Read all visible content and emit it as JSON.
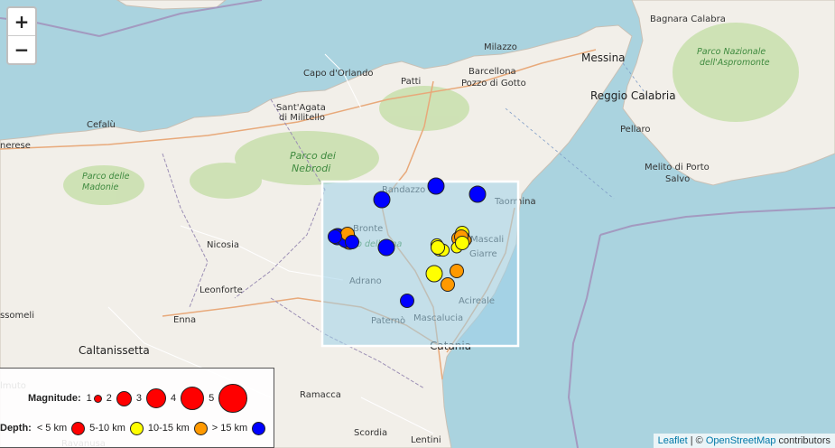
{
  "map": {
    "zoom_in_label": "+",
    "zoom_out_label": "−",
    "places": [
      {
        "name": "Bagnara Calabra",
        "cls": "place"
      },
      {
        "name": "Milazzo",
        "cls": "place"
      },
      {
        "name": "Messina",
        "cls": "place-lg"
      },
      {
        "name": "Capo d'Orlando",
        "cls": "place"
      },
      {
        "name": "Barcellona",
        "cls": "place"
      },
      {
        "name": "Pozzo di Gotto",
        "cls": "place"
      },
      {
        "name": "Patti",
        "cls": "place"
      },
      {
        "name": "Reggio Calabria",
        "cls": "place-lg"
      },
      {
        "name": "Sant'Agata",
        "cls": "place"
      },
      {
        "name": "di Militello",
        "cls": "place"
      },
      {
        "name": "Cefalù",
        "cls": "place"
      },
      {
        "name": "nerese",
        "cls": "place"
      },
      {
        "name": "Pellaro",
        "cls": "place"
      },
      {
        "name": "Melito di Porto",
        "cls": "place"
      },
      {
        "name": "Salvo",
        "cls": "place"
      },
      {
        "name": "Randazzo",
        "cls": "place"
      },
      {
        "name": "Taormina",
        "cls": "place"
      },
      {
        "name": "Bronte",
        "cls": "place"
      },
      {
        "name": "Mascali",
        "cls": "place"
      },
      {
        "name": "Giarre",
        "cls": "place"
      },
      {
        "name": "Nicosia",
        "cls": "place"
      },
      {
        "name": "Adrano",
        "cls": "place"
      },
      {
        "name": "Acireale",
        "cls": "place"
      },
      {
        "name": "Leonforte",
        "cls": "place"
      },
      {
        "name": "Paternò",
        "cls": "place"
      },
      {
        "name": "Mascalucia",
        "cls": "place"
      },
      {
        "name": "ssomeli",
        "cls": "place"
      },
      {
        "name": "Enna",
        "cls": "place"
      },
      {
        "name": "Caltanissetta",
        "cls": "place-lg"
      },
      {
        "name": "Catania",
        "cls": "place-lg"
      },
      {
        "name": "Ramacca",
        "cls": "place"
      },
      {
        "name": "Scordia",
        "cls": "place"
      },
      {
        "name": "Lentini",
        "cls": "place"
      },
      {
        "name": "lmuto",
        "cls": "place"
      },
      {
        "name": "Ravanusa",
        "cls": "place"
      }
    ],
    "parks": [
      {
        "name": "Parco dei",
        "cls": "park-lg"
      },
      {
        "name": "Nebrodi",
        "cls": "park-lg"
      },
      {
        "name": "Parco delle",
        "cls": "park"
      },
      {
        "name": "Madonie",
        "cls": "park"
      },
      {
        "name": "Parco Nazionale",
        "cls": "park"
      },
      {
        "name": "dell'Aspromonte",
        "cls": "park"
      },
      {
        "name": "rco dell'Etna",
        "cls": "park"
      }
    ],
    "events": [
      {
        "depth_class": "> 15 km",
        "magnitude": 2
      },
      {
        "depth_class": "> 15 km",
        "magnitude": 2
      },
      {
        "depth_class": "> 15 km",
        "magnitude": 2
      },
      {
        "depth_class": "> 15 km",
        "magnitude": 2
      },
      {
        "depth_class": "10-15 km",
        "magnitude": 2
      },
      {
        "depth_class": "> 15 km",
        "magnitude": 2
      },
      {
        "depth_class": "10-15 km",
        "magnitude": 1.5
      },
      {
        "depth_class": "> 15 km",
        "magnitude": 2
      },
      {
        "depth_class": "> 15 km",
        "magnitude": 1.5
      },
      {
        "depth_class": "10-15 km",
        "magnitude": 1.5
      },
      {
        "depth_class": "10-15 km",
        "magnitude": 1.5
      },
      {
        "depth_class": "5-10 km",
        "magnitude": 2
      },
      {
        "depth_class": "5-10 km",
        "magnitude": 1.5
      },
      {
        "depth_class": "10-15 km",
        "magnitude": 1.5
      },
      {
        "depth_class": "5-10 km",
        "magnitude": 1.2
      },
      {
        "depth_class": "5-10 km",
        "magnitude": 1.5
      },
      {
        "depth_class": "5-10 km",
        "magnitude": 1.2
      },
      {
        "depth_class": "5-10 km",
        "magnitude": 1
      },
      {
        "depth_class": "10-15 km",
        "magnitude": 1.2
      },
      {
        "depth_class": "10-15 km",
        "magnitude": 1
      },
      {
        "depth_class": "> 15 km",
        "magnitude": 1.5
      },
      {
        "depth_class": "5-10 km",
        "magnitude": 1.5
      },
      {
        "depth_class": "10-15 km",
        "magnitude": 1.5
      },
      {
        "depth_class": "> 15 km",
        "magnitude": 1.5
      },
      {
        "depth_class": "5-10 km",
        "magnitude": 1.5
      }
    ]
  },
  "legend": {
    "magnitude_label": "Magnitude:",
    "magnitude_steps": [
      "1",
      "2",
      "3",
      "4",
      "5"
    ],
    "depth_label": "Depth:",
    "depth_classes": [
      {
        "label": "< 5 km",
        "color": "#ff0000"
      },
      {
        "label": "5-10 km",
        "color": "#ffff00"
      },
      {
        "label": "10-15 km",
        "color": "#ff9900"
      },
      {
        "label": "> 15 km",
        "color": "#0000ff"
      }
    ]
  },
  "colors": {
    "sea": "#aad3df",
    "land": "#f2efe9",
    "forest": "#c8dfac",
    "box_fill": "#9fd1ea",
    "box_border": "#ffffff"
  },
  "attribution": {
    "leaflet": "Leaflet",
    "separator": " | © ",
    "osm": "OpenStreetMap",
    "suffix": " contributors"
  }
}
